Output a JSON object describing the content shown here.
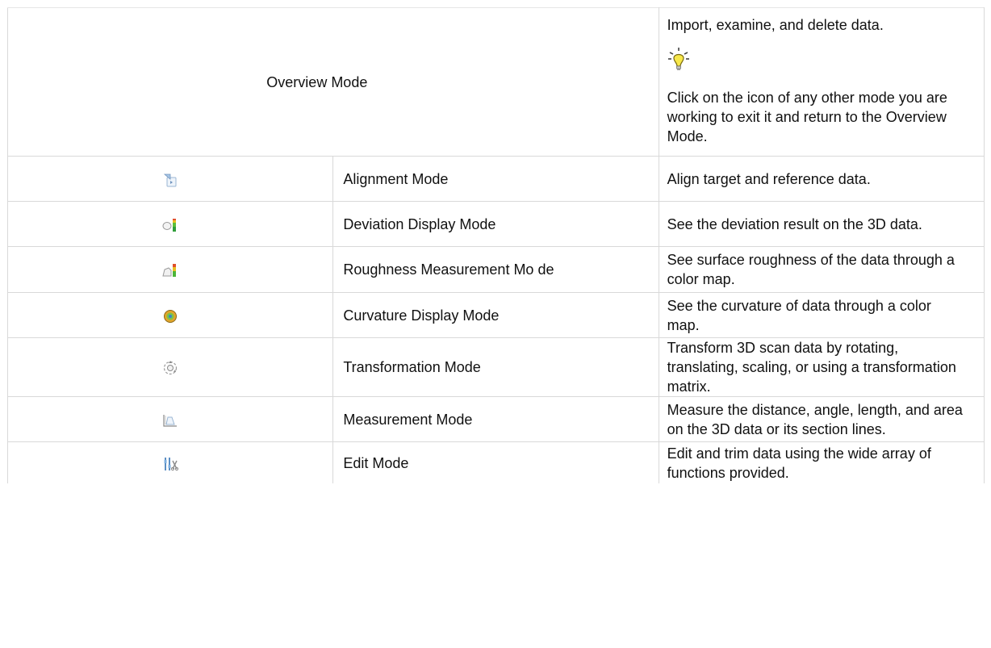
{
  "overview": {
    "name": "Overview Mode",
    "description_lead": "Import, examine, and delete data.",
    "tip_icon": "lightbulb-icon",
    "description_tip": "Click on the icon of any other mode you are working to exit it and return to the Overview Mode."
  },
  "modes": [
    {
      "icon": "alignment-mode-icon",
      "name": "Alignment Mode",
      "description": "Align target and reference data."
    },
    {
      "icon": "deviation-display-mode-icon",
      "name": "Deviation Display Mode",
      "description": "See the deviation result on the 3D data."
    },
    {
      "icon": "roughness-measurement-mode-icon",
      "name": "Roughness Measurement Mo de",
      "description": "See surface roughness of the data through a color map."
    },
    {
      "icon": "curvature-display-mode-icon",
      "name": "Curvature Display Mode",
      "description": "See the curvature of data through a color map."
    },
    {
      "icon": "transformation-mode-icon",
      "name": "Transformation Mode",
      "description": "Transform 3D scan data by rotating, translating, scaling, or using a transformation matrix."
    },
    {
      "icon": "measurement-mode-icon",
      "name": "Measurement Mode",
      "description": "Measure the distance, angle, length, and area on the 3D data or its section lines."
    },
    {
      "icon": "edit-mode-icon",
      "name": "Edit Mode",
      "description": "Edit and trim data using the wide array of functions provided."
    }
  ]
}
